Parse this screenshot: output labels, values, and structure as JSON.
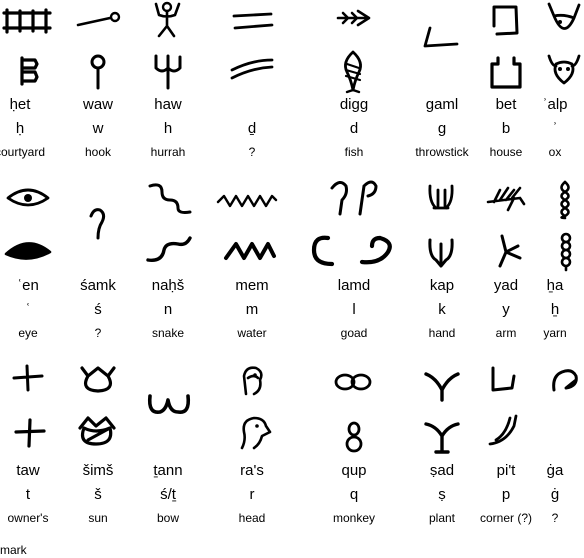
{
  "rows": [
    {
      "entries": [
        {
          "id": "het",
          "name": "ḥet",
          "translit": "ḥ",
          "meaning": "courtyard"
        },
        {
          "id": "waw",
          "name": "waw",
          "translit": "w",
          "meaning": "hook"
        },
        {
          "id": "haw",
          "name": "haw",
          "translit": "h",
          "meaning": "hurrah"
        },
        {
          "id": "dh",
          "name": "",
          "translit": "ḏ",
          "meaning": "?"
        },
        {
          "id": "digg",
          "name": "digg",
          "translit": "d",
          "meaning": "fish"
        },
        {
          "id": "gaml",
          "name": "gaml",
          "translit": "g",
          "meaning": "throwstick"
        },
        {
          "id": "bet",
          "name": "bet",
          "translit": "b",
          "meaning": "house"
        },
        {
          "id": "alp",
          "name": "ʾalp",
          "translit": "ʾ",
          "meaning": "ox"
        }
      ]
    },
    {
      "entries": [
        {
          "id": "en",
          "name": "ʿen",
          "translit": "ʿ",
          "meaning": "eye"
        },
        {
          "id": "samk",
          "name": "śamk",
          "translit": "ś",
          "meaning": "?"
        },
        {
          "id": "nahs",
          "name": "naḥš",
          "translit": "n",
          "meaning": "snake"
        },
        {
          "id": "mem",
          "name": "mem",
          "translit": "m",
          "meaning": "water"
        },
        {
          "id": "lamd",
          "name": "lamd",
          "translit": "l",
          "meaning": "goad"
        },
        {
          "id": "kap",
          "name": "kap",
          "translit": "k",
          "meaning": "hand"
        },
        {
          "id": "yad",
          "name": "yad",
          "translit": "y",
          "meaning": "arm"
        },
        {
          "id": "ha",
          "name": "ẖa",
          "translit": "ẖ",
          "meaning": "yarn"
        }
      ]
    },
    {
      "entries": [
        {
          "id": "taw",
          "name": "taw",
          "translit": "t",
          "meaning": "owner's",
          "meaning_cont": "mark"
        },
        {
          "id": "sims",
          "name": "šimš",
          "translit": "š",
          "meaning": "sun"
        },
        {
          "id": "tann",
          "name": "ṯann",
          "translit": "ś/ṯ",
          "meaning": "bow"
        },
        {
          "id": "ras",
          "name": "ra's",
          "translit": "r",
          "meaning": "head"
        },
        {
          "id": "qup",
          "name": "qup",
          "translit": "q",
          "meaning": "monkey"
        },
        {
          "id": "sad",
          "name": "ṣad",
          "translit": "ṣ",
          "meaning": "plant"
        },
        {
          "id": "pit",
          "name": "pi't",
          "translit": "p",
          "meaning": "corner (?)"
        },
        {
          "id": "ga",
          "name": "ġa",
          "translit": "ġ",
          "meaning": "?"
        }
      ]
    }
  ]
}
